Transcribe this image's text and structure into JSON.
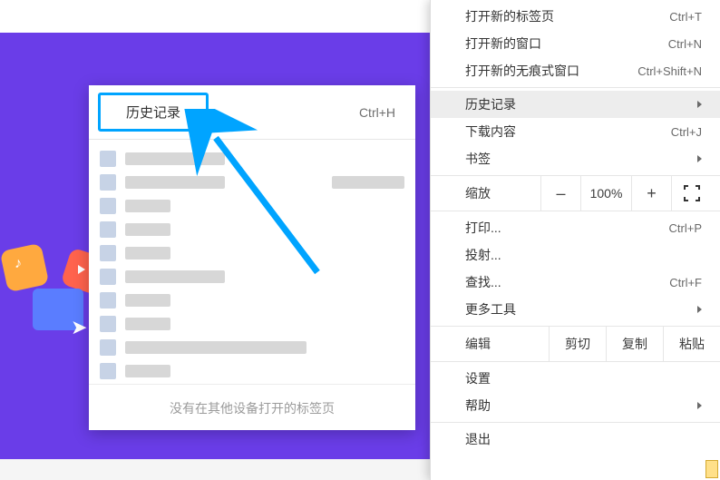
{
  "submenu": {
    "title": "历史记录",
    "shortcut": "Ctrl+H",
    "footer_note": "没有在其他设备打开的标签页"
  },
  "main_menu": {
    "section1": [
      {
        "label": "打开新的标签页",
        "shortcut": "Ctrl+T"
      },
      {
        "label": "打开新的窗口",
        "shortcut": "Ctrl+N"
      },
      {
        "label": "打开新的无痕式窗口",
        "shortcut": "Ctrl+Shift+N"
      }
    ],
    "section2": [
      {
        "label": "历史记录",
        "has_submenu": true,
        "highlight": true
      },
      {
        "label": "下载内容",
        "shortcut": "Ctrl+J"
      },
      {
        "label": "书签",
        "has_submenu": true
      }
    ],
    "zoom": {
      "label": "缩放",
      "value": "100%",
      "minus": "–",
      "plus": "+"
    },
    "section3": [
      {
        "label": "打印...",
        "shortcut": "Ctrl+P"
      },
      {
        "label": "投射..."
      },
      {
        "label": "查找...",
        "shortcut": "Ctrl+F"
      },
      {
        "label": "更多工具",
        "has_submenu": true
      }
    ],
    "edit": {
      "label": "编辑",
      "cut": "剪切",
      "copy": "复制",
      "paste": "粘贴"
    },
    "section4": [
      {
        "label": "设置"
      },
      {
        "label": "帮助",
        "has_submenu": true
      }
    ],
    "section5": [
      {
        "label": "退出"
      }
    ]
  }
}
